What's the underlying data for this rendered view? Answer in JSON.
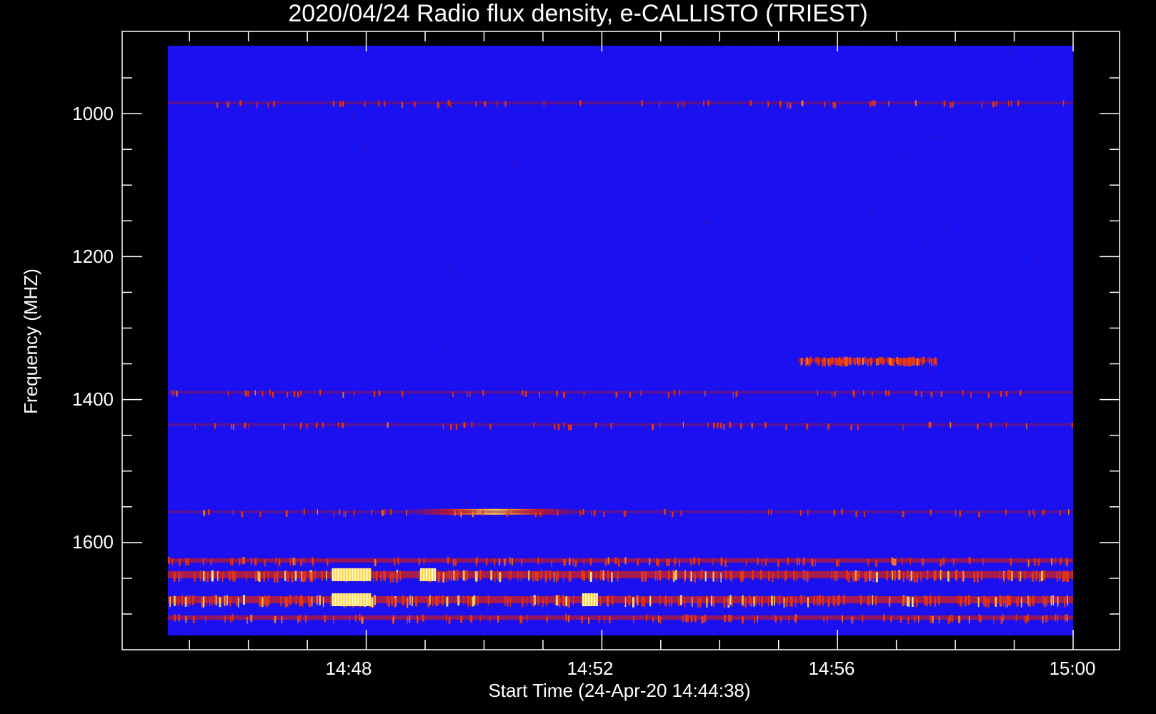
{
  "chart_data": {
    "type": "heatmap",
    "title": "2020/04/24  Radio flux density, e-CALLISTO (TRIEST)",
    "xlabel": "Start Time (24-Apr-20 14:44:38)",
    "ylabel": "Frequency (MHZ)",
    "x_ticks": [
      "14:48",
      "14:52",
      "14:56",
      "15:00"
    ],
    "y_ticks": [
      "1000",
      "1200",
      "1400",
      "1600"
    ],
    "y_axis_inverted": true,
    "x_range": [
      "14:44:38",
      "15:00:00"
    ],
    "y_range_mhz": [
      905,
      1730
    ],
    "colors": {
      "background": "#000000",
      "low_intensity": "#1a10f0",
      "mid_intensity": "#cc1010",
      "high_intensity": "#ffff80",
      "axes": "#ffffff"
    },
    "features": [
      {
        "freq_mhz": 985,
        "time_start": "14:44:38",
        "time_end": "15:00:00",
        "intensity": "low"
      },
      {
        "freq_mhz": 1345,
        "time_start": "14:55:20",
        "time_end": "14:57:40",
        "intensity": "medium"
      },
      {
        "freq_mhz": 1390,
        "time_start": "14:44:38",
        "time_end": "15:00:00",
        "intensity": "low"
      },
      {
        "freq_mhz": 1435,
        "time_start": "14:44:38",
        "time_end": "15:00:00",
        "intensity": "low"
      },
      {
        "freq_mhz": 1557,
        "time_start": "14:48:40",
        "time_end": "14:51:40",
        "intensity": "high"
      },
      {
        "freq_mhz": 1557,
        "time_start": "14:44:38",
        "time_end": "15:00:00",
        "intensity": "low"
      },
      {
        "freq_mhz": 1625,
        "time_start": "14:44:38",
        "time_end": "15:00:00",
        "intensity": "medium"
      },
      {
        "freq_mhz": 1645,
        "time_start": "14:44:38",
        "time_end": "15:00:00",
        "intensity": "high"
      },
      {
        "freq_mhz": 1680,
        "time_start": "14:44:38",
        "time_end": "15:00:00",
        "intensity": "high"
      },
      {
        "freq_mhz": 1705,
        "time_start": "14:44:38",
        "time_end": "15:00:00",
        "intensity": "medium"
      }
    ]
  }
}
